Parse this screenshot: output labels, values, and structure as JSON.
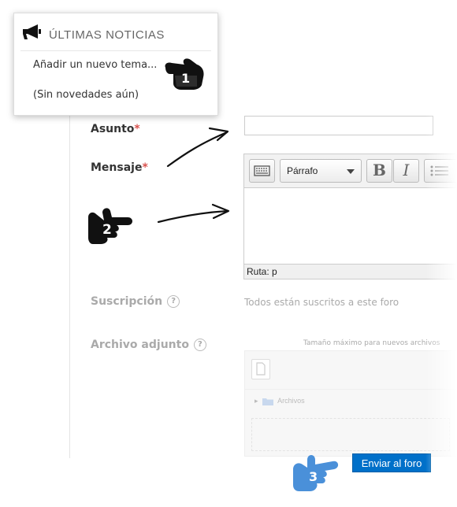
{
  "popup": {
    "title": "ÚLTIMAS NOTICIAS",
    "add_link": "Añadir un nuevo tema...",
    "empty_text": "(Sin novedades aún)"
  },
  "form": {
    "asunto_label": "Asunto",
    "mensaje_label": "Mensaje",
    "required_mark": "*",
    "suscripcion_label": "Suscripción",
    "suscripcion_value": "Todos están suscritos a este foro",
    "archivo_label": "Archivo adjunto",
    "archivo_hint": "Tamaño máximo para nuevos archivos",
    "filepicker_folder": "Archivos",
    "help_glyph": "?"
  },
  "editor": {
    "format_select": "Párrafo",
    "bold_label": "B",
    "italic_label": "I",
    "status_path": "Ruta: p"
  },
  "buttons": {
    "send_label": "Enviar al foro"
  },
  "annotations": {
    "step1": "1",
    "step2": "2",
    "step3": "3"
  },
  "colors": {
    "required": "#d9534f",
    "primary_button": "#0070c9",
    "pointer_blue": "#4a90d9"
  }
}
